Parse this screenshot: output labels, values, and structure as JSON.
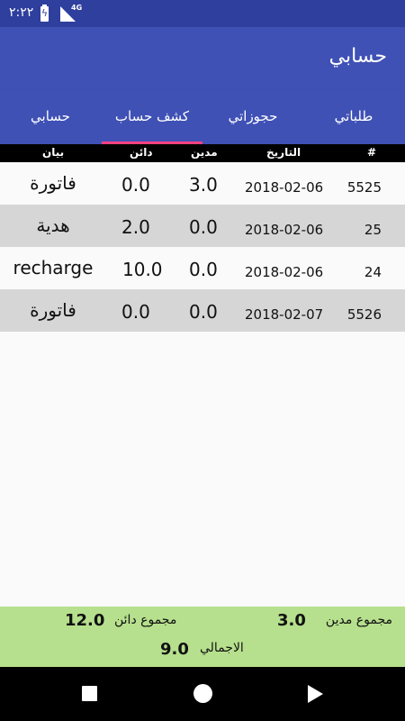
{
  "status_bar": {
    "time": "٢:٢٢",
    "network": "4G"
  },
  "app_bar": {
    "title": "حسابي"
  },
  "tabs": [
    {
      "label": "طلباتي"
    },
    {
      "label": "حجوزاتي"
    },
    {
      "label": "كشف حساب"
    },
    {
      "label": "حسابي"
    }
  ],
  "table": {
    "headers": {
      "id": "#",
      "date": "التاريخ",
      "debit": "مدين",
      "credit": "دائن",
      "description": "بيان"
    },
    "rows": [
      {
        "id": "5525",
        "date": "2018-02-06",
        "debit": "3.0",
        "credit": "0.0",
        "description": "فاتورة"
      },
      {
        "id": "25",
        "date": "2018-02-06",
        "debit": "0.0",
        "credit": "2.0",
        "description": "هدية"
      },
      {
        "id": "24",
        "date": "2018-02-06",
        "debit": "0.0",
        "credit": "10.0",
        "description": "recharge"
      },
      {
        "id": "5526",
        "date": "2018-02-07",
        "debit": "0.0",
        "credit": "0.0",
        "description": "فاتورة"
      }
    ]
  },
  "summary": {
    "debit_label": "مجموع مدين",
    "debit_value": "3.0",
    "credit_label": "مجموع دائن",
    "credit_value": "12.0",
    "total_label": "الاجمالي",
    "total_value": "9.0"
  },
  "colors": {
    "primary": "#3f51b5",
    "status_bar": "#2e3f9e",
    "accent": "#ff4081",
    "summary_bg": "#b6e08d",
    "alt_row": "#d6d6d6"
  }
}
